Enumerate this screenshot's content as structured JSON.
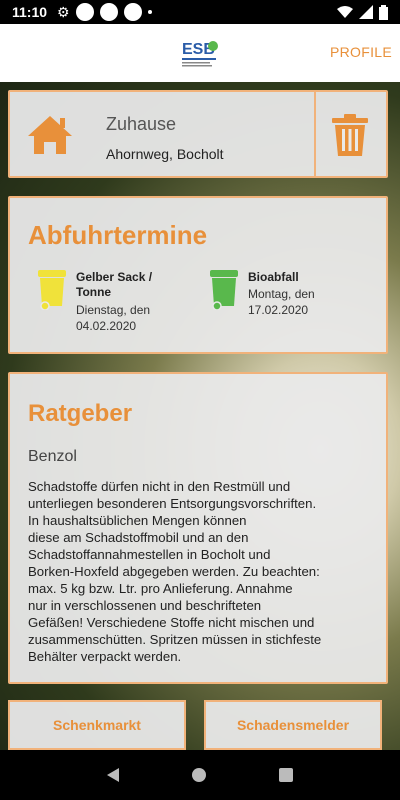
{
  "status": {
    "time": "11:10"
  },
  "appbar": {
    "profile_label": "PROFILE",
    "logo_text": "ESB"
  },
  "address": {
    "name": "Zuhause",
    "street": "Ahornweg, Bocholt"
  },
  "pickup": {
    "title": "Abfuhrtermine",
    "items": [
      {
        "name": "Gelber Sack / Tonne",
        "date": "Dienstag, den 04.02.2020",
        "color": "#f0e23a"
      },
      {
        "name": "Bioabfall",
        "date": "Montag, den 17.02.2020",
        "color": "#59b84c"
      }
    ]
  },
  "advice": {
    "title": "Ratgeber",
    "subtitle": "Benzol",
    "text": "Schadstoffe dürfen nicht in den Restmüll und\nunterliegen besonderen Entsorgungsvorschriften.\nIn haushaltsüblichen Mengen können\ndiese am Schadstoffmobil und an den\nSchadstoffannahmestellen in Bocholt und\nBorken-Hoxfeld abgegeben werden. Zu beachten:\nmax. 5 kg bzw. Ltr.  pro Anlieferung. Annahme\nnur in verschlossenen und beschrifteten\nGefäßen! Verschiedene Stoffe nicht mischen und\nzusammenschütten. Spritzen müssen in stichfeste\nBehälter verpackt werden."
  },
  "buttons": {
    "left": "Schenkmarkt",
    "right": "Schadensmelder"
  },
  "colors": {
    "accent": "#e8903a",
    "border": "#f1b27a"
  }
}
